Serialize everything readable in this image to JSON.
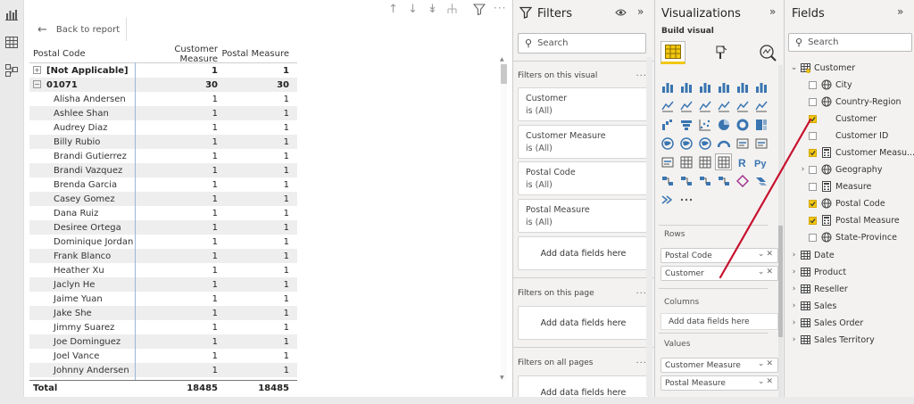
{
  "canvas": {
    "back_label": "Back to report",
    "table": {
      "headers": [
        "Postal Code",
        "Customer Measure",
        "Postal Measure"
      ],
      "groups": [
        {
          "label": "[Not Applicable]",
          "customer_measure": "1",
          "postal_measure": "1"
        },
        {
          "label": "01071",
          "customer_measure": "30",
          "postal_measure": "30"
        }
      ],
      "rows": [
        {
          "name": "Alisha Andersen",
          "cm": "1",
          "pm": "1"
        },
        {
          "name": "Ashlee Shan",
          "cm": "1",
          "pm": "1"
        },
        {
          "name": "Audrey Diaz",
          "cm": "1",
          "pm": "1"
        },
        {
          "name": "Billy Rubio",
          "cm": "1",
          "pm": "1"
        },
        {
          "name": "Brandi Gutierrez",
          "cm": "1",
          "pm": "1"
        },
        {
          "name": "Brandi Vazquez",
          "cm": "1",
          "pm": "1"
        },
        {
          "name": "Brenda Garcia",
          "cm": "1",
          "pm": "1"
        },
        {
          "name": "Casey Gomez",
          "cm": "1",
          "pm": "1"
        },
        {
          "name": "Dana Ruiz",
          "cm": "1",
          "pm": "1"
        },
        {
          "name": "Desiree Ortega",
          "cm": "1",
          "pm": "1"
        },
        {
          "name": "Dominique Jordan",
          "cm": "1",
          "pm": "1"
        },
        {
          "name": "Frank Blanco",
          "cm": "1",
          "pm": "1"
        },
        {
          "name": "Heather Xu",
          "cm": "1",
          "pm": "1"
        },
        {
          "name": "Jaclyn He",
          "cm": "1",
          "pm": "1"
        },
        {
          "name": "Jaime Yuan",
          "cm": "1",
          "pm": "1"
        },
        {
          "name": "Jake She",
          "cm": "1",
          "pm": "1"
        },
        {
          "name": "Jimmy Suarez",
          "cm": "1",
          "pm": "1"
        },
        {
          "name": "Joe Dominguez",
          "cm": "1",
          "pm": "1"
        },
        {
          "name": "Joel Vance",
          "cm": "1",
          "pm": "1"
        },
        {
          "name": "Johnny Andersen",
          "cm": "1",
          "pm": "1"
        }
      ],
      "total": {
        "label": "Total",
        "customer_measure": "18485",
        "postal_measure": "18485"
      }
    }
  },
  "filters": {
    "title": "Filters",
    "search_placeholder": "Search",
    "visual_section": "Filters on this visual",
    "visual_cards": [
      {
        "field": "Customer",
        "state": "is (All)"
      },
      {
        "field": "Customer Measure",
        "state": "is (All)"
      },
      {
        "field": "Postal Code",
        "state": "is (All)"
      },
      {
        "field": "Postal Measure",
        "state": "is (All)"
      }
    ],
    "add_fields": "Add data fields here",
    "page_section": "Filters on this page",
    "all_pages_section": "Filters on all pages"
  },
  "visualizations": {
    "title": "Visualizations",
    "build_visual": "Build visual",
    "rows_label": "Rows",
    "rows_fields": [
      "Postal Code",
      "Customer"
    ],
    "columns_label": "Columns",
    "columns_placeholder": "Add data fields here",
    "values_label": "Values",
    "values_fields": [
      "Customer Measure",
      "Postal Measure"
    ]
  },
  "fields": {
    "title": "Fields",
    "search_placeholder": "Search",
    "items": [
      {
        "label": "Customer",
        "level": 0,
        "kind": "table",
        "expanded": true,
        "checked": "partial"
      },
      {
        "label": "City",
        "level": 1,
        "kind": "geo",
        "checked": false
      },
      {
        "label": "Country-Region",
        "level": 1,
        "kind": "geo",
        "checked": false
      },
      {
        "label": "Customer",
        "level": 1,
        "kind": "text",
        "checked": true
      },
      {
        "label": "Customer ID",
        "level": 1,
        "kind": "text",
        "checked": false
      },
      {
        "label": "Customer Measu...",
        "level": 1,
        "kind": "measure",
        "checked": true
      },
      {
        "label": "Geography",
        "level": 1,
        "kind": "hierarchy",
        "checked": false
      },
      {
        "label": "Measure",
        "level": 1,
        "kind": "measure",
        "checked": false
      },
      {
        "label": "Postal Code",
        "level": 1,
        "kind": "geo",
        "checked": true
      },
      {
        "label": "Postal Measure",
        "level": 1,
        "kind": "measure",
        "checked": true
      },
      {
        "label": "State-Province",
        "level": 1,
        "kind": "geo",
        "checked": false
      },
      {
        "label": "Date",
        "level": 0,
        "kind": "table"
      },
      {
        "label": "Product",
        "level": 0,
        "kind": "table"
      },
      {
        "label": "Reseller",
        "level": 0,
        "kind": "table"
      },
      {
        "label": "Sales",
        "level": 0,
        "kind": "table"
      },
      {
        "label": "Sales Order",
        "level": 0,
        "kind": "table"
      },
      {
        "label": "Sales Territory",
        "level": 0,
        "kind": "table"
      }
    ]
  },
  "colors": {
    "accent": "#f2c811",
    "annotation": "#c8102e",
    "selection_line": "#9ab7d6"
  }
}
